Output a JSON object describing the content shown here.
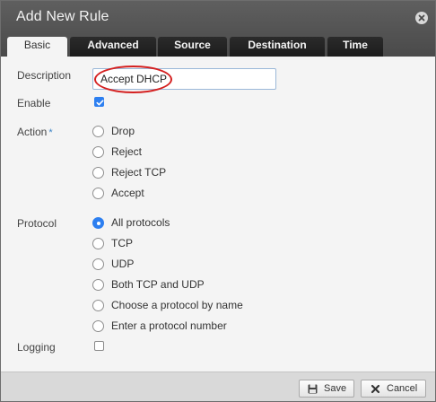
{
  "dialog": {
    "title": "Add New Rule"
  },
  "tabs": [
    {
      "label": "Basic",
      "active": true
    },
    {
      "label": "Advanced",
      "active": false
    },
    {
      "label": "Source",
      "active": false
    },
    {
      "label": "Destination",
      "active": false
    },
    {
      "label": "Time",
      "active": false
    }
  ],
  "form": {
    "description_label": "Description",
    "description_value": "Accept DHCP",
    "enable_label": "Enable",
    "enable_checked": true,
    "action_label": "Action",
    "action_required_mark": "*",
    "action_options": [
      "Drop",
      "Reject",
      "Reject TCP",
      "Accept"
    ],
    "action_selected": null,
    "protocol_label": "Protocol",
    "protocol_options": [
      "All protocols",
      "TCP",
      "UDP",
      "Both TCP and UDP",
      "Choose a protocol by name",
      "Enter a protocol number"
    ],
    "protocol_selected": "All protocols",
    "logging_label": "Logging",
    "logging_checked": false
  },
  "footer": {
    "save_label": "Save",
    "cancel_label": "Cancel"
  },
  "colors": {
    "accent": "#2d7ff0",
    "titlebar": "#555555",
    "annotation": "#d42020"
  },
  "icons": {
    "close": "close-icon",
    "save": "save-icon",
    "cancel": "cancel-icon"
  }
}
